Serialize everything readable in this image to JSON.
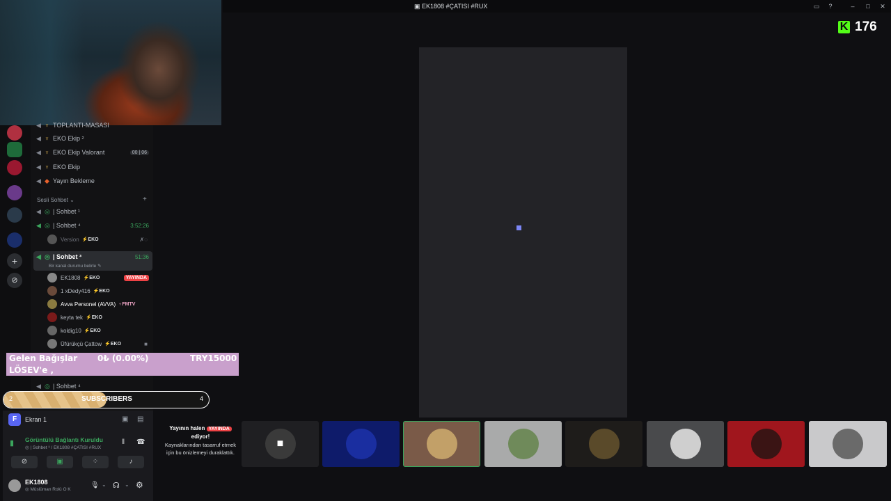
{
  "window": {
    "title": "EK1808 #ÇATISI #RUX"
  },
  "kick": {
    "logo": "K",
    "viewer_count": "176"
  },
  "channels": {
    "cut_top": "TOPLANTI-MASASI",
    "voice": [
      {
        "label": "EKO Ekip ²"
      },
      {
        "label": "EKO Ekip Valorant",
        "counter_a": "00",
        "counter_b": "06"
      },
      {
        "label": "EKO Ekip"
      },
      {
        "label": "Yayın Bekleme"
      }
    ],
    "category": "Sesli Sohbet",
    "chat_rooms": [
      {
        "label": "| Sohbet ¹"
      },
      {
        "label": "| Sohbet ⁴",
        "timer": "3:52:26"
      }
    ],
    "room4_users": [
      {
        "name": "Version",
        "tag": "EKO"
      }
    ],
    "selected": {
      "label": "| Sohbet ³",
      "timer": "51:36",
      "status": "Bir kanal durumu belirle"
    },
    "room3_users": [
      {
        "name": "EK1808",
        "tag": "EKO",
        "badge": "YAYINDA"
      },
      {
        "name": "1 xDedy416",
        "tag": "EKO"
      },
      {
        "name": "Avva Personel (AVVA)",
        "tag": "FMTV"
      },
      {
        "name": "keyta tek",
        "tag": "EKO"
      },
      {
        "name": "koldig10",
        "tag": "EKO"
      },
      {
        "name": "Üfürükçü Çattow",
        "tag": "EKO"
      }
    ],
    "cut_bottom": "| Sohbet ⁴"
  },
  "donation": {
    "label": "Gelen Bağışlar",
    "amount": "0₺ (0.00%)",
    "goal": "TRY15000",
    "target": "LÖSEV'e ,"
  },
  "subscribers": {
    "label": "SUBSCRIBERS",
    "current": "2",
    "goal": "4",
    "progress": 0.5
  },
  "screen_share": {
    "avatar_letter": "F",
    "label": "Ekran 1"
  },
  "connection": {
    "status": "Görüntülü Bağlantı Kuruldu",
    "detail": "| Sohbet ³ / EK1808 #ÇATISI #RUX"
  },
  "user_panel": {
    "name": "EK1808",
    "status": "Müslüman Rolü O K"
  },
  "stream_notice": {
    "line1": "Yayının halen",
    "badge": "YAYINDA",
    "line2": "ediyor!",
    "body": "Kaynaklarından tasarruf etmek için bu önizlemeyi duraklattık."
  },
  "colors": {
    "accent": "#5865f2",
    "live": "#ed4245",
    "kick_green": "#53fc18",
    "connected": "#3ba55d"
  }
}
